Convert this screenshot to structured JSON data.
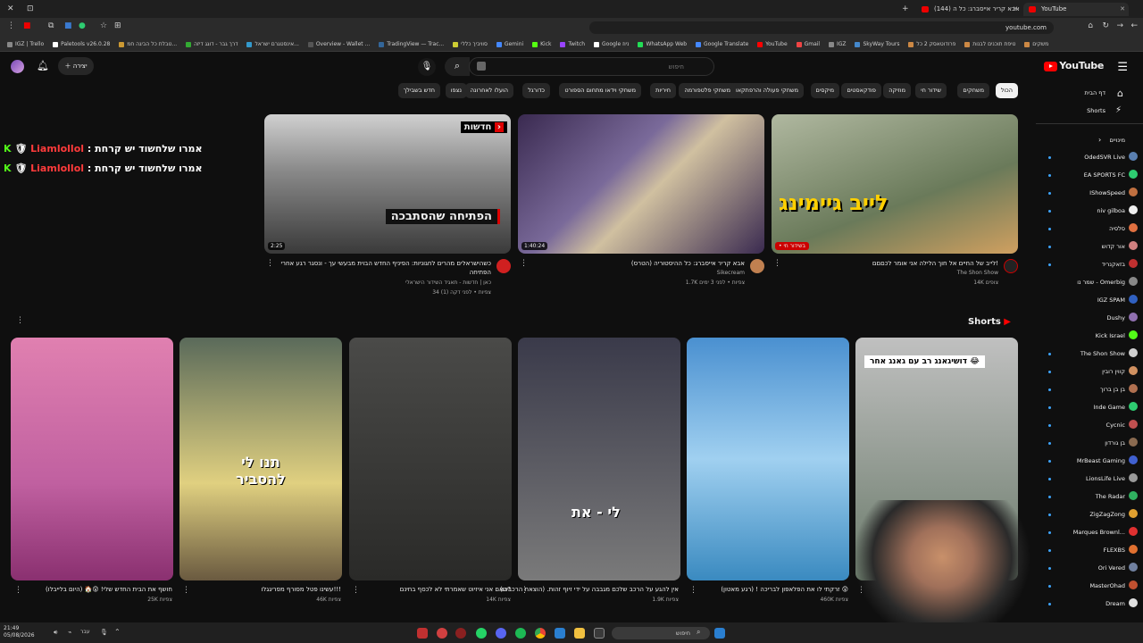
{
  "browser": {
    "tabs": [
      {
        "title": "YouTube",
        "active": true
      },
      {
        "title": "(144) אבא קריר אייסברג: כל ה",
        "active": false
      }
    ],
    "url": "youtube.com",
    "bookmarks": [
      "IGZ | Trello",
      "Paletools v26.0.28",
      "טבלת כל הביגה חמ...",
      "דרך גבר - דוגג דיזה",
      "אינסטגרם ישראל...",
      "Overview - Wallet ...",
      "TradingView — Trac...",
      "סוויביך כללי",
      "Gemini",
      "Kick",
      "Twitch",
      "Google ניוז",
      "WhatsApp Web",
      "Google Translate",
      "YouTube",
      "Gmail",
      "IGZ",
      "SkyWay Tours",
      "פרודוטאסק 2 כל",
      "טיפת תוכנים לבנות",
      "משקים",
      "כל הסימניות"
    ]
  },
  "masthead": {
    "logo_text": "YouTube",
    "search_placeholder": "חיפוש",
    "search_value": "",
    "create_label": "יצירה"
  },
  "chips": [
    "הכול",
    "משחקים",
    "שידור חי",
    "מוזיקה",
    "פודקאסטים",
    "מיקסים",
    "משחקי פעולה והרפתקאות",
    "משחקי פלטפורמה",
    "חיריות",
    "משחקי וידאו מתחום הספורט",
    "כדורגל",
    "הועלו לאחרונה",
    "נצפו",
    "חדש בשבילך"
  ],
  "sidebar": {
    "home": "דף הבית",
    "shorts": "Shorts",
    "subs_header": "מינויים",
    "channels": [
      {
        "name": "OdedSVR Live",
        "color": "#5a7fb0",
        "live": true
      },
      {
        "name": "EA SPORTS FC",
        "color": "#2ecc71",
        "live": true
      },
      {
        "name": "IShowSpeed",
        "color": "#c07040",
        "live": true
      },
      {
        "name": "niv gilboa",
        "color": "#eeeeee",
        "live": true
      },
      {
        "name": "סלסיה",
        "color": "#e07040",
        "live": true
      },
      {
        "name": "אור קדוש",
        "color": "#d08080",
        "live": true
      },
      {
        "name": "בזאקנריד",
        "color": "#c03030",
        "live": true
      },
      {
        "name": "שמר נו - Omerbig",
        "color": "#888888",
        "live": false
      },
      {
        "name": "IGZ SPAM",
        "color": "#3060c0",
        "live": false
      },
      {
        "name": "Dushy",
        "color": "#9070b0",
        "live": false
      },
      {
        "name": "Kick Israel",
        "color": "#53fc18",
        "live": false
      },
      {
        "name": "The Shon Show",
        "color": "#d0d0d0",
        "live": true
      },
      {
        "name": "קווין רובין",
        "color": "#d09060",
        "live": true
      },
      {
        "name": "בן בן ברוך",
        "color": "#b07050",
        "live": true
      },
      {
        "name": "Inde Game",
        "color": "#2ecc71",
        "live": true
      },
      {
        "name": "Cycnic",
        "color": "#c05050",
        "live": true
      },
      {
        "name": "בן גורדון",
        "color": "#8a6a50",
        "live": true
      },
      {
        "name": "MrBeast Gaming",
        "color": "#4060d0",
        "live": true
      },
      {
        "name": "LionsLife Live",
        "color": "#9a9a9a",
        "live": true
      },
      {
        "name": "The Radar",
        "color": "#30b060",
        "live": true
      },
      {
        "name": "ZigZagZong",
        "color": "#e0a030",
        "live": true
      },
      {
        "name": "Marques Brownl...",
        "color": "#e03030",
        "live": true
      },
      {
        "name": "FLEXBS",
        "color": "#e07030",
        "live": true
      },
      {
        "name": "Ori Vered",
        "color": "#7080a0",
        "live": true
      },
      {
        "name": "MasterOhad",
        "color": "#c05030",
        "live": true
      },
      {
        "name": "Dream",
        "color": "#e0e0e0",
        "live": true
      }
    ]
  },
  "overlay_chat": [
    {
      "badge": "K",
      "name": "Liamlollol",
      "sep": ":",
      "msg": "אמרו שלחשוד יש קרחת"
    },
    {
      "badge": "K",
      "name": "Liamlollol",
      "sep": ":",
      "msg": "אמרו שלחשוד יש קרחת"
    }
  ],
  "videos": [
    {
      "title": "לייב של החיים אל חוך הלילה אני אומר לכםםם!",
      "channel": "The Shon Show",
      "meta": "14K צופים",
      "overlay": "לייב גיימינג",
      "badge": "• בשידור חי",
      "thumb_bg": "#7a8a6a"
    },
    {
      "title": "אבא קריר אייסברג: כל ההיסטוריה (הטרס)",
      "channel": "Sikecream",
      "meta": "1.7K צפיות • לפני 3 ימים",
      "duration": "1:40:24",
      "thumb_bg": "#4a3a60"
    },
    {
      "title": "כשהישראלים מהרים לחגוניות: הפיניף החדש הבוית מבעשי עך - ונסגר רגע אחרי הפתיחה",
      "channel": "כאן | חדשות - תאגיד השידור הישראלי",
      "meta": "34 צפיות • לפני דקה (1)",
      "duration": "2:25",
      "overlay": "הפתיחה שהסתבכה",
      "badge": "חדשות",
      "thumb_bg": "#6a6a6a"
    }
  ],
  "shorts_header": "Shorts",
  "shorts": [
    {
      "title": "זרקתי לו את הפלאפון לבריכה ! (רגע מאטון) 😲",
      "views": "460K צפיות",
      "overlay": "דושיגאנג רב עם גאנג אחר 😂",
      "bg": "#7a7a6a"
    },
    {
      "title": "אין להגע על הרכב שלכם מגבבה על ידי זיוף זהות. (הוצאת הרכבים)",
      "views": "1.9K צפיות",
      "overlay": "לי - את",
      "bg": "#5aa0d0"
    },
    {
      "title": "האם אני איזיוט שאמרתי לא לכסף בחינם?",
      "views": "14K צפיות",
      "overlay": "",
      "bg": "#6a6a68"
    },
    {
      "title": "עשינו פטל מסורף מפריגגלו!!!",
      "views": "46K צפיות",
      "overlay": "תנו לי להסביר",
      "bg": "#5a4a3a"
    },
    {
      "title": "חושף את הבית החדש שלי! 😲🏠 (היום בלייבלו)",
      "views": "25K צפיות",
      "overlay": "",
      "bg": "#8a9a7a"
    },
    {
      "title": "",
      "views": "",
      "overlay": "",
      "bg": "#d070a0"
    }
  ],
  "taskbar": {
    "search_placeholder": "חיפוש",
    "time": "21:49",
    "date": "05/08/2026",
    "weather": "עבר"
  }
}
